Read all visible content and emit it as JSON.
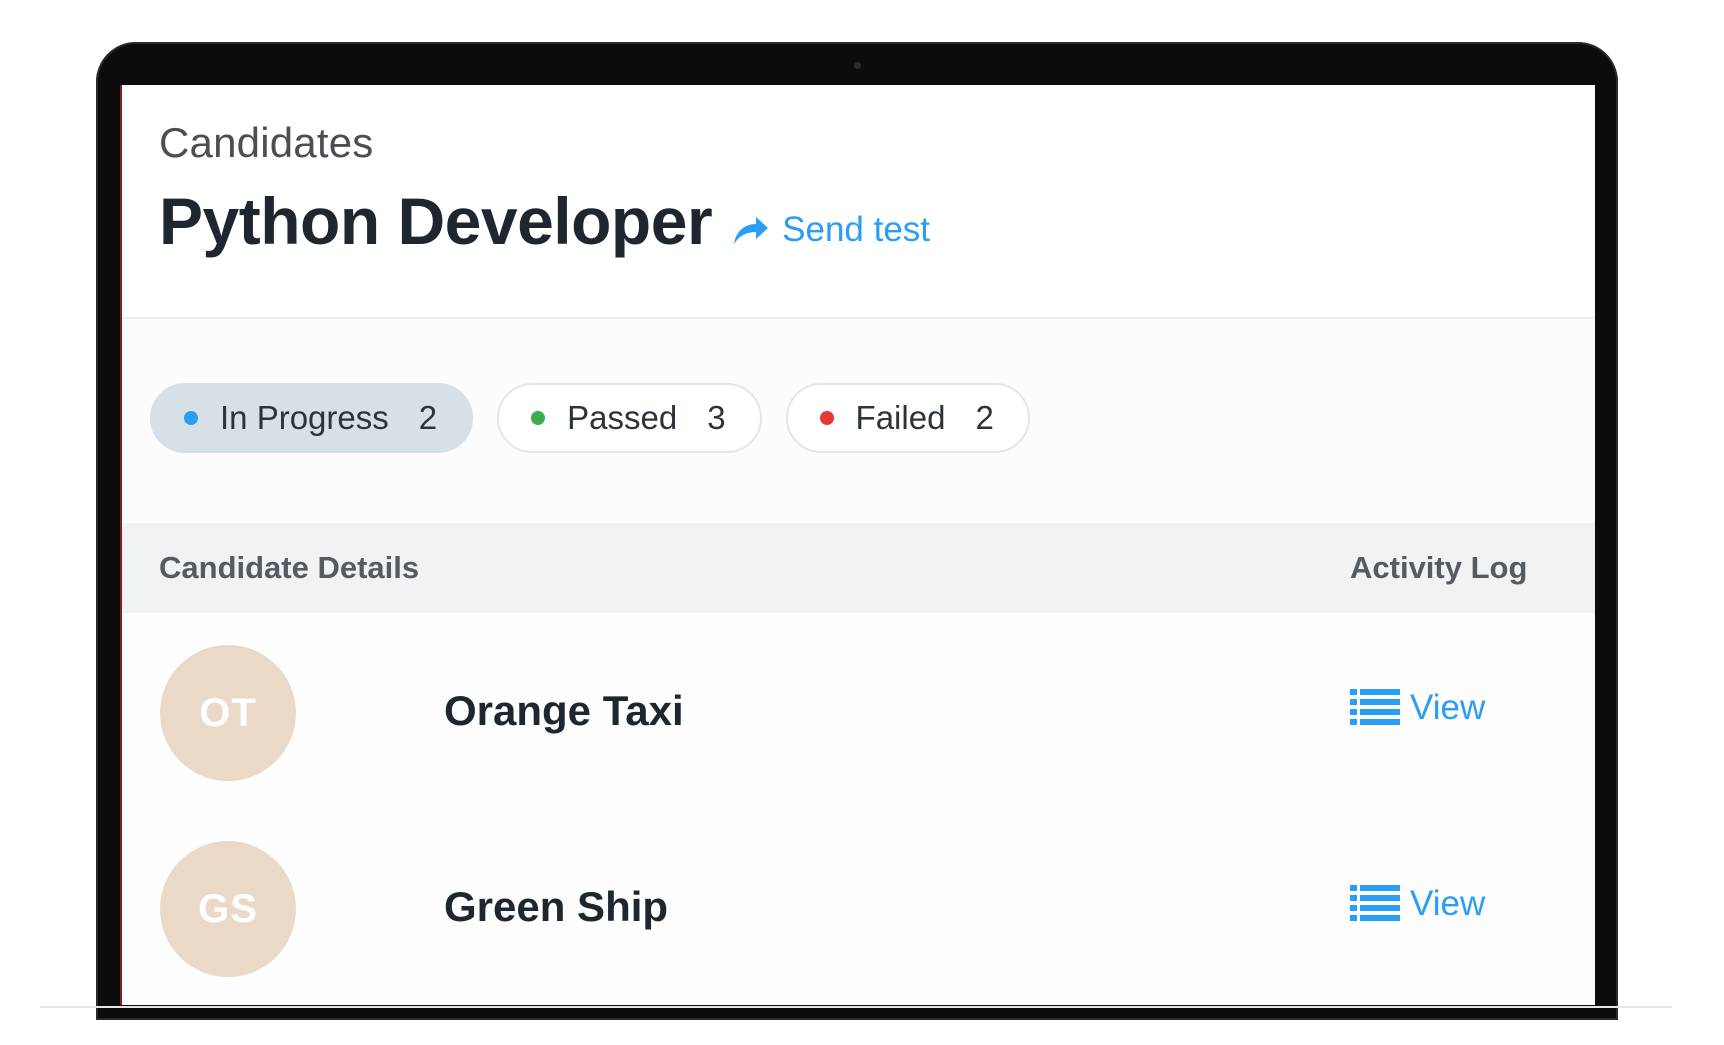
{
  "header": {
    "breadcrumb": "Candidates",
    "title": "Python Developer",
    "send_test_label": "Send test",
    "send_test_icon": "share-arrow-icon"
  },
  "filters": [
    {
      "label": "In Progress",
      "count": "2",
      "dot_color": "#2a9df4",
      "active": true
    },
    {
      "label": "Passed",
      "count": "3",
      "dot_color": "#3cae4a",
      "active": false
    },
    {
      "label": "Failed",
      "count": "2",
      "dot_color": "#e53935",
      "active": false
    }
  ],
  "table": {
    "columns": [
      "Candidate Details",
      "Activity Log"
    ],
    "rows": [
      {
        "initials": "OT",
        "name": "Orange Taxi",
        "action": "View",
        "action_icon": "list-icon"
      },
      {
        "initials": "GS",
        "name": "Green Ship",
        "action": "View",
        "action_icon": "list-icon"
      }
    ]
  },
  "colors": {
    "accent": "#2a9df4",
    "avatar_bg": "#ead9c6",
    "active_pill_bg": "#d6e0e6"
  }
}
